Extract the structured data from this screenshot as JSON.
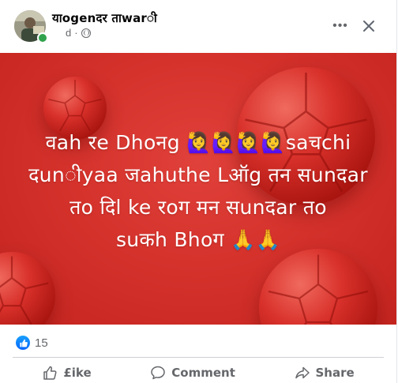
{
  "post": {
    "author_name": "याogenदर ताwarी",
    "time": "d",
    "text": "वah रe Dhoनg 🙋‍♀️🙋‍♀️🙋‍♀️🙋‍♀️saचchi\nदunीyaa जahuthe Lऑg तन सunदar\nतo दिl ke रoग मन सunदar तo\nsuकh Bhoग 🙏🙏",
    "reaction_count": "15"
  },
  "actions": {
    "like_label": "£ike",
    "comment_label": "Comment",
    "share_label": "Share"
  },
  "colors": {
    "background_red": "#d5322c",
    "like_blue": "#0866ff",
    "online_green": "#31a24c"
  },
  "icons": {
    "more": "more-horizontal-icon",
    "close": "close-icon",
    "privacy": "globe-icon",
    "like_reaction": "thumbs-up-icon",
    "like_action": "thumbs-up-outline-icon",
    "comment_action": "comment-icon",
    "share_action": "share-arrow-icon"
  }
}
